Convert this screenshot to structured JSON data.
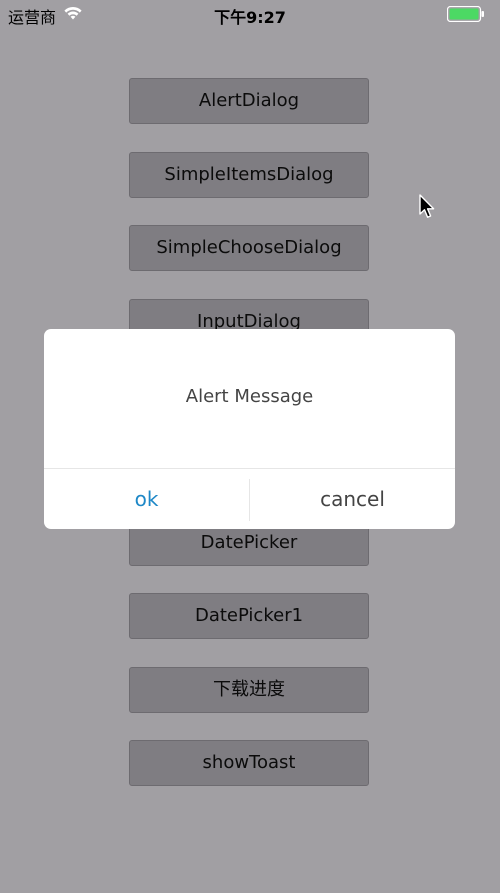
{
  "status_bar": {
    "carrier": "运营商",
    "time": "下午9:27",
    "wifi_icon": "wifi-icon",
    "battery_icon": "battery-icon",
    "battery_color": "#4cd964"
  },
  "buttons": [
    {
      "label": "AlertDialog"
    },
    {
      "label": "SimpleItemsDialog"
    },
    {
      "label": "SimpleChooseDialog"
    },
    {
      "label": "InputDialog"
    },
    {
      "label": "DatePicker"
    },
    {
      "label": "DatePicker1"
    },
    {
      "label": "下载进度"
    },
    {
      "label": "showToast"
    }
  ],
  "dialog": {
    "message": "Alert Message",
    "ok_label": "ok",
    "cancel_label": "cancel",
    "ok_color": "#1e88c7"
  },
  "colors": {
    "background": "#a19fa3",
    "button_fill": "#7f7d82"
  }
}
